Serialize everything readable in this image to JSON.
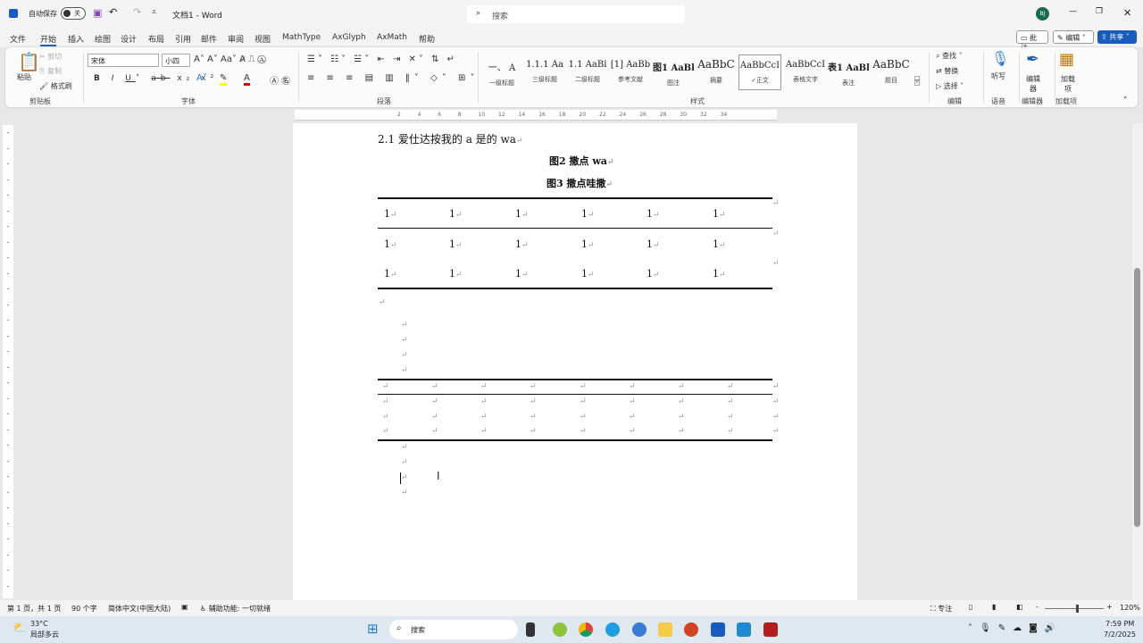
{
  "titlebar": {
    "autosave": "自动保存",
    "toggle": "关",
    "doc_title": "文档1 - Word",
    "search_placeholder": "搜索",
    "avatar": "BJ"
  },
  "tabs": [
    "文件",
    "开始",
    "插入",
    "绘图",
    "设计",
    "布局",
    "引用",
    "邮件",
    "审阅",
    "视图",
    "MathType",
    "AxGlyph",
    "AxMath",
    "帮助"
  ],
  "actions": {
    "comment": "批注",
    "edit": "编辑",
    "share": "共享"
  },
  "ribbon": {
    "clipboard": {
      "paste": "粘贴",
      "cut": "剪切",
      "copy": "复制",
      "format_painter": "格式刷",
      "label": "剪贴板"
    },
    "font": {
      "name": "宋体",
      "size": "小四",
      "label": "字体"
    },
    "paragraph": {
      "label": "段落"
    },
    "styles": {
      "label": "样式",
      "items": [
        {
          "preview": "一、 A",
          "name": "一级标题"
        },
        {
          "preview": "1.1.1 Aa",
          "name": "三级标题"
        },
        {
          "preview": "1.1 AaBl",
          "name": "二级标题"
        },
        {
          "preview": "[1] AaBb",
          "name": "参考文献"
        },
        {
          "preview": "图1 AaBl",
          "name": "图注"
        },
        {
          "preview": "AaBbC",
          "name": "摘要"
        },
        {
          "preview": "AaBbCcI",
          "name": "✓正文"
        },
        {
          "preview": "AaBbCcI",
          "name": "表格文字"
        },
        {
          "preview": "表1 AaBl",
          "name": "表注"
        },
        {
          "preview": "AaBbC",
          "name": "题目"
        }
      ]
    },
    "editing": {
      "find": "查找",
      "replace": "替换",
      "select": "选择",
      "label": "编辑"
    },
    "voice": {
      "dictate": "听写",
      "label": "语音"
    },
    "editor": {
      "btn": "编辑器",
      "label": "编辑器"
    },
    "addins": {
      "btn": "加载项",
      "label": "加载项"
    }
  },
  "ruler_ticks": [
    "2",
    "4",
    "6",
    "8",
    "10",
    "12",
    "14",
    "16",
    "18",
    "20",
    "22",
    "24",
    "26",
    "28",
    "30",
    "32",
    "34"
  ],
  "document": {
    "heading": "2.1 爱仕达按我的 a 是的 wa",
    "caption1": "图2 撒点 wa",
    "caption2": "图3 撒点哇撒",
    "table1": [
      [
        "1",
        "1",
        "1",
        "1",
        "1",
        "1"
      ],
      [
        "1",
        "1",
        "1",
        "1",
        "1",
        "1"
      ],
      [
        "1",
        "1",
        "1",
        "1",
        "1",
        "1"
      ]
    ],
    "para_mark": "↵"
  },
  "status": {
    "page": "第 1 页，共 1 页",
    "words": "90 个字",
    "language": "简体中文(中国大陆)",
    "accessibility": "辅助功能: 一切就绪",
    "focus": "专注",
    "zoom": "120%",
    "zoom_level": 120
  },
  "taskbar": {
    "temp": "33°C",
    "weather": "局部多云",
    "search": "搜索",
    "time": "7:59 PM",
    "date": "7/2/2025"
  }
}
